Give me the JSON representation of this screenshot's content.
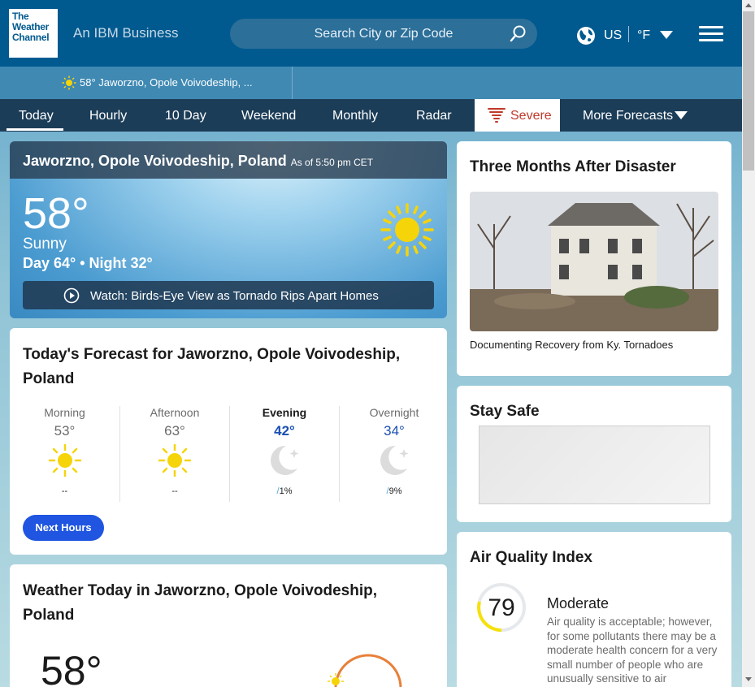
{
  "header": {
    "logo_lines": [
      "The",
      "Weather",
      "Channel"
    ],
    "tagline": "An IBM Business",
    "search_placeholder": "Search City or Zip Code",
    "locale": "US",
    "unit": "°F"
  },
  "recent": {
    "location": "58° Jaworzno, Opole Voivodeship, ..."
  },
  "nav": {
    "items": [
      "Today",
      "Hourly",
      "10 Day",
      "Weekend",
      "Monthly",
      "Radar",
      "Severe",
      "More Forecasts"
    ]
  },
  "current": {
    "location": "Jaworzno, Opole Voivodeship, Poland",
    "as_of": "As of 5:50 pm CET",
    "temperature": "58°",
    "phrase": "Sunny",
    "day_night": "Day 64° • Night 32°",
    "video_label": "Watch:  Birds-Eye View as Tornado Rips Apart Homes"
  },
  "forecast": {
    "title": "Today's Forecast for Jaworzno, Opole Voivodeship, Poland",
    "periods": [
      {
        "label": "Morning",
        "temp": "53°",
        "icon": "sun-icon",
        "precip": "--"
      },
      {
        "label": "Afternoon",
        "temp": "63°",
        "icon": "sun-icon",
        "precip": "--"
      },
      {
        "label": "Evening",
        "temp": "42°",
        "icon": "moon-icon",
        "precip": "1%"
      },
      {
        "label": "Overnight",
        "temp": "34°",
        "icon": "moon-icon",
        "precip": "9%"
      }
    ],
    "button": "Next Hours"
  },
  "weather_today": {
    "title": "Weather Today in Jaworzno, Opole Voivodeship, Poland",
    "temperature": "58°"
  },
  "news": {
    "title": "Three Months After Disaster",
    "caption": "Documenting Recovery from Ky. Tornadoes"
  },
  "stay_safe": {
    "title": "Stay Safe"
  },
  "aqi": {
    "title": "Air Quality Index",
    "value": "79",
    "category": "Moderate",
    "description": "Air quality is acceptable; however, for some pollutants there may be a moderate health concern for a very small number of people who are unusually sensitive to air"
  },
  "colors": {
    "header_bg": "#005a8f",
    "nav_bg": "#1c3d58",
    "accent_blue": "#1f55e0",
    "severe_red": "#c0392b",
    "sun_yellow": "#f5d40a"
  }
}
